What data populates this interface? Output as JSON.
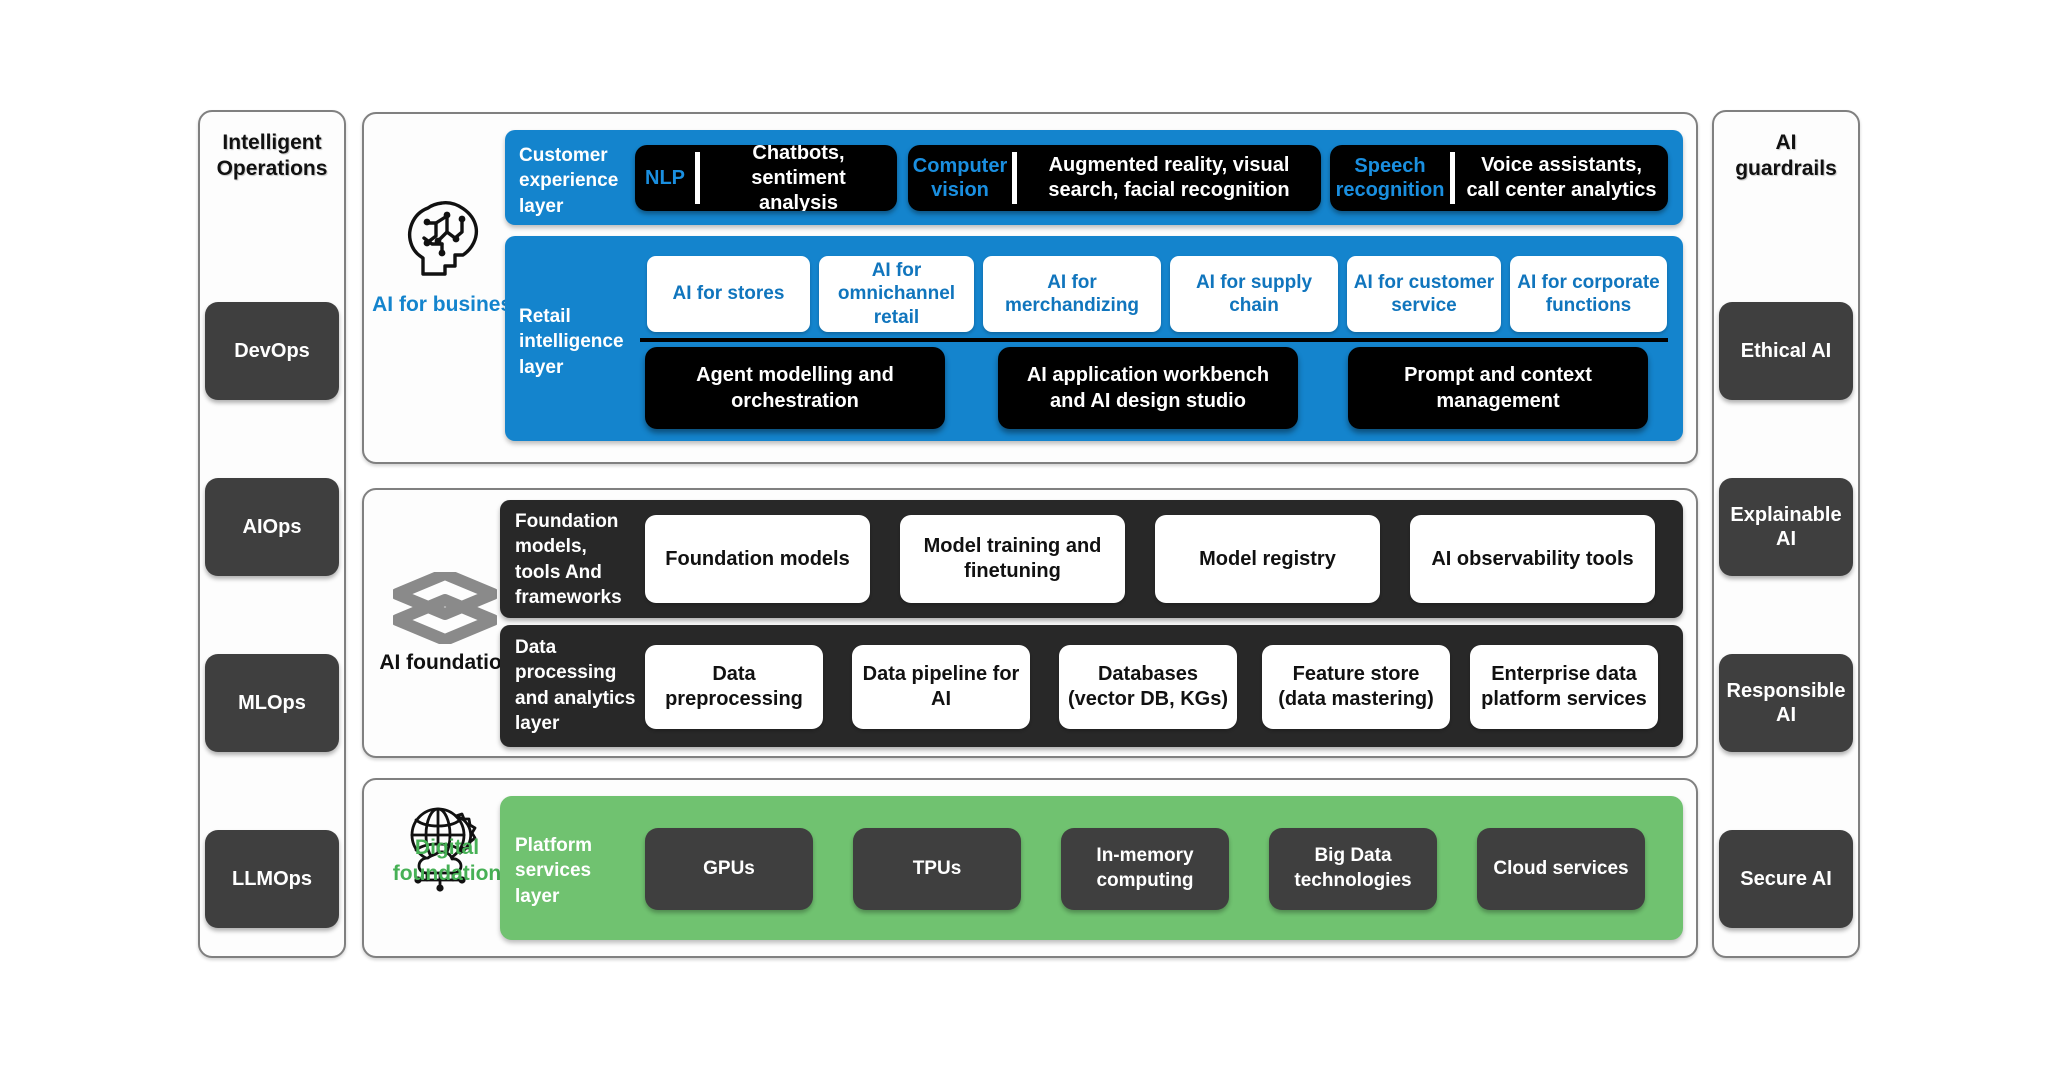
{
  "colors": {
    "blue": "#1484cd",
    "blue_text": "#1a8fe0",
    "chip_blue_text": "#1075bd",
    "green": "#70c270",
    "green_text": "#46b055",
    "dark_band": "#282828",
    "pill_gray": "#3f3f3f",
    "panel_border": "#808080",
    "black": "#000000",
    "white": "#ffffff"
  },
  "left_rail": {
    "title": "Intelligent Operations",
    "title_line1": "Intelligent",
    "title_line2": "Operations",
    "items": [
      {
        "label": "DevOps"
      },
      {
        "label": "AIOps"
      },
      {
        "label": "MLOps"
      },
      {
        "label": "LLMOps"
      }
    ]
  },
  "right_rail": {
    "title": "AI guardrails",
    "title_line1": "AI",
    "title_line2": "guardrails",
    "items": [
      {
        "label": "Ethical AI"
      },
      {
        "label": "Explainable AI"
      },
      {
        "label": "Responsible AI"
      },
      {
        "label": "Secure AI"
      }
    ]
  },
  "sections": [
    {
      "id": "ai-for-business",
      "icon": "brain-circuit-head-icon",
      "icon_label": "AI for business",
      "icon_label_color": "#1484cd"
    },
    {
      "id": "ai-foundation",
      "icon": "stacked-layers-icon",
      "icon_label": "AI foundation",
      "icon_label_color": "#111111"
    },
    {
      "id": "digital-foundation",
      "icon": "globe-gear-cloud-icon",
      "icon_label": "Digital foundation",
      "icon_label_color": "#46b055"
    }
  ],
  "customer_experience_layer": {
    "label": "Customer experience layer",
    "blocks": [
      {
        "lead": "NLP",
        "body": "Chatbots, sentiment analysis"
      },
      {
        "lead": "Computer vision",
        "body": "Augmented reality, visual search, facial recognition"
      },
      {
        "lead": "Speech recognition",
        "body": "Voice assistants, call center analytics"
      }
    ]
  },
  "retail_intelligence_layer": {
    "label": "Retail intelligence layer",
    "domains": [
      {
        "label": "AI for stores"
      },
      {
        "label": "AI for omnichannel retail"
      },
      {
        "label": "AI for merchandizing"
      },
      {
        "label": "AI for supply chain"
      },
      {
        "label": "AI for customer service"
      },
      {
        "label": "AI for corporate functions"
      }
    ],
    "platform_blocks": [
      {
        "label": "Agent modelling and orchestration"
      },
      {
        "label": "AI application workbench and AI design studio"
      },
      {
        "label": "Prompt and context management"
      }
    ]
  },
  "foundation_models_layer": {
    "label": "Foundation models, tools And frameworks",
    "items": [
      {
        "label": "Foundation models"
      },
      {
        "label": "Model training and finetuning"
      },
      {
        "label": "Model registry"
      },
      {
        "label": "AI observability tools"
      }
    ]
  },
  "data_processing_layer": {
    "label": "Data processing and analytics layer",
    "items": [
      {
        "label": "Data preprocessing"
      },
      {
        "label": "Data pipeline for AI"
      },
      {
        "label": "Databases (vector DB, KGs)"
      },
      {
        "label": "Feature store (data mastering)"
      },
      {
        "label": "Enterprise data platform services"
      }
    ]
  },
  "platform_services_layer": {
    "label": "Platform services layer",
    "items": [
      {
        "label": "GPUs"
      },
      {
        "label": "TPUs"
      },
      {
        "label": "In-memory computing"
      },
      {
        "label": "Big Data technologies"
      },
      {
        "label": "Cloud services"
      }
    ]
  }
}
